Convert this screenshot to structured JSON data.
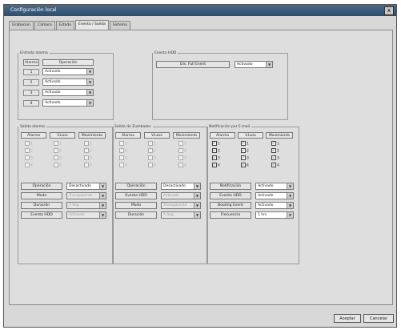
{
  "window": {
    "title": "Configuración local",
    "close_label": "x"
  },
  "tabs": [
    "Grabacion",
    "Cámara",
    "Estado",
    "Evento / Salida",
    "Sistema"
  ],
  "entrada_alarma": {
    "legend": "Entrada alarma",
    "col_alarma": "Alarma",
    "col_operacion": "Operación",
    "rows": [
      {
        "num": "1",
        "value": "Activado"
      },
      {
        "num": "2",
        "value": "Activado"
      },
      {
        "num": "3",
        "value": "Activado"
      },
      {
        "num": "4",
        "value": "Activado"
      }
    ]
  },
  "evento_hdd": {
    "legend": "Evento HDD",
    "label": "Dis. Full Event",
    "value": "Activado"
  },
  "salida_alarma": {
    "legend": "Salida alarma",
    "cols": [
      "Alarma",
      "V.Loss",
      "Movimiento"
    ],
    "rows": [
      [
        "1",
        "1",
        "1"
      ],
      [
        "2",
        "2",
        "2"
      ],
      [
        "3",
        "3",
        "3"
      ],
      [
        "4",
        "4",
        "4"
      ]
    ],
    "fields": [
      {
        "label": "Operación",
        "value": "Desactivado",
        "disabled": false
      },
      {
        "label": "Modo",
        "value": "Transparente",
        "disabled": true
      },
      {
        "label": "Duración",
        "value": "5 Seg",
        "disabled": true
      },
      {
        "label": "Evento HDD",
        "value": "Activado",
        "disabled": true
      }
    ]
  },
  "salida_zumbador": {
    "legend": "Salida de Zumbador",
    "cols": [
      "Alarma",
      "V.Loss",
      "Movimiento"
    ],
    "rows": [
      [
        "1",
        "1",
        "1"
      ],
      [
        "2",
        "2",
        "2"
      ],
      [
        "3",
        "3",
        "3"
      ],
      [
        "4",
        "4",
        "4"
      ]
    ],
    "fields": [
      {
        "label": "Operación",
        "value": "Desactivado",
        "disabled": false
      },
      {
        "label": "Evento HDD",
        "value": "Activado",
        "disabled": true
      },
      {
        "label": "Modo",
        "value": "Transparente",
        "disabled": true
      },
      {
        "label": "Duración",
        "value": "5 Seg",
        "disabled": true
      }
    ]
  },
  "notificacion_email": {
    "legend": "Notificación por E-mail",
    "cols": [
      "Alarma",
      "V.Loss",
      "Movimiento"
    ],
    "rows": [
      [
        "1",
        "1",
        "1"
      ],
      [
        "2",
        "2",
        "2"
      ],
      [
        "3",
        "3",
        "3"
      ],
      [
        "4",
        "4",
        "4"
      ]
    ],
    "fields": [
      {
        "label": "Notificación",
        "value": "Activado",
        "disabled": false
      },
      {
        "label": "Evento HDD",
        "value": "Activado",
        "disabled": false
      },
      {
        "label": "Booting Event",
        "value": "Activado",
        "disabled": false
      },
      {
        "label": "Frecuencia",
        "value": "1 hrs",
        "disabled": false
      }
    ]
  },
  "buttons": {
    "apply": "Aceptar",
    "cancel": "Cancelar"
  }
}
